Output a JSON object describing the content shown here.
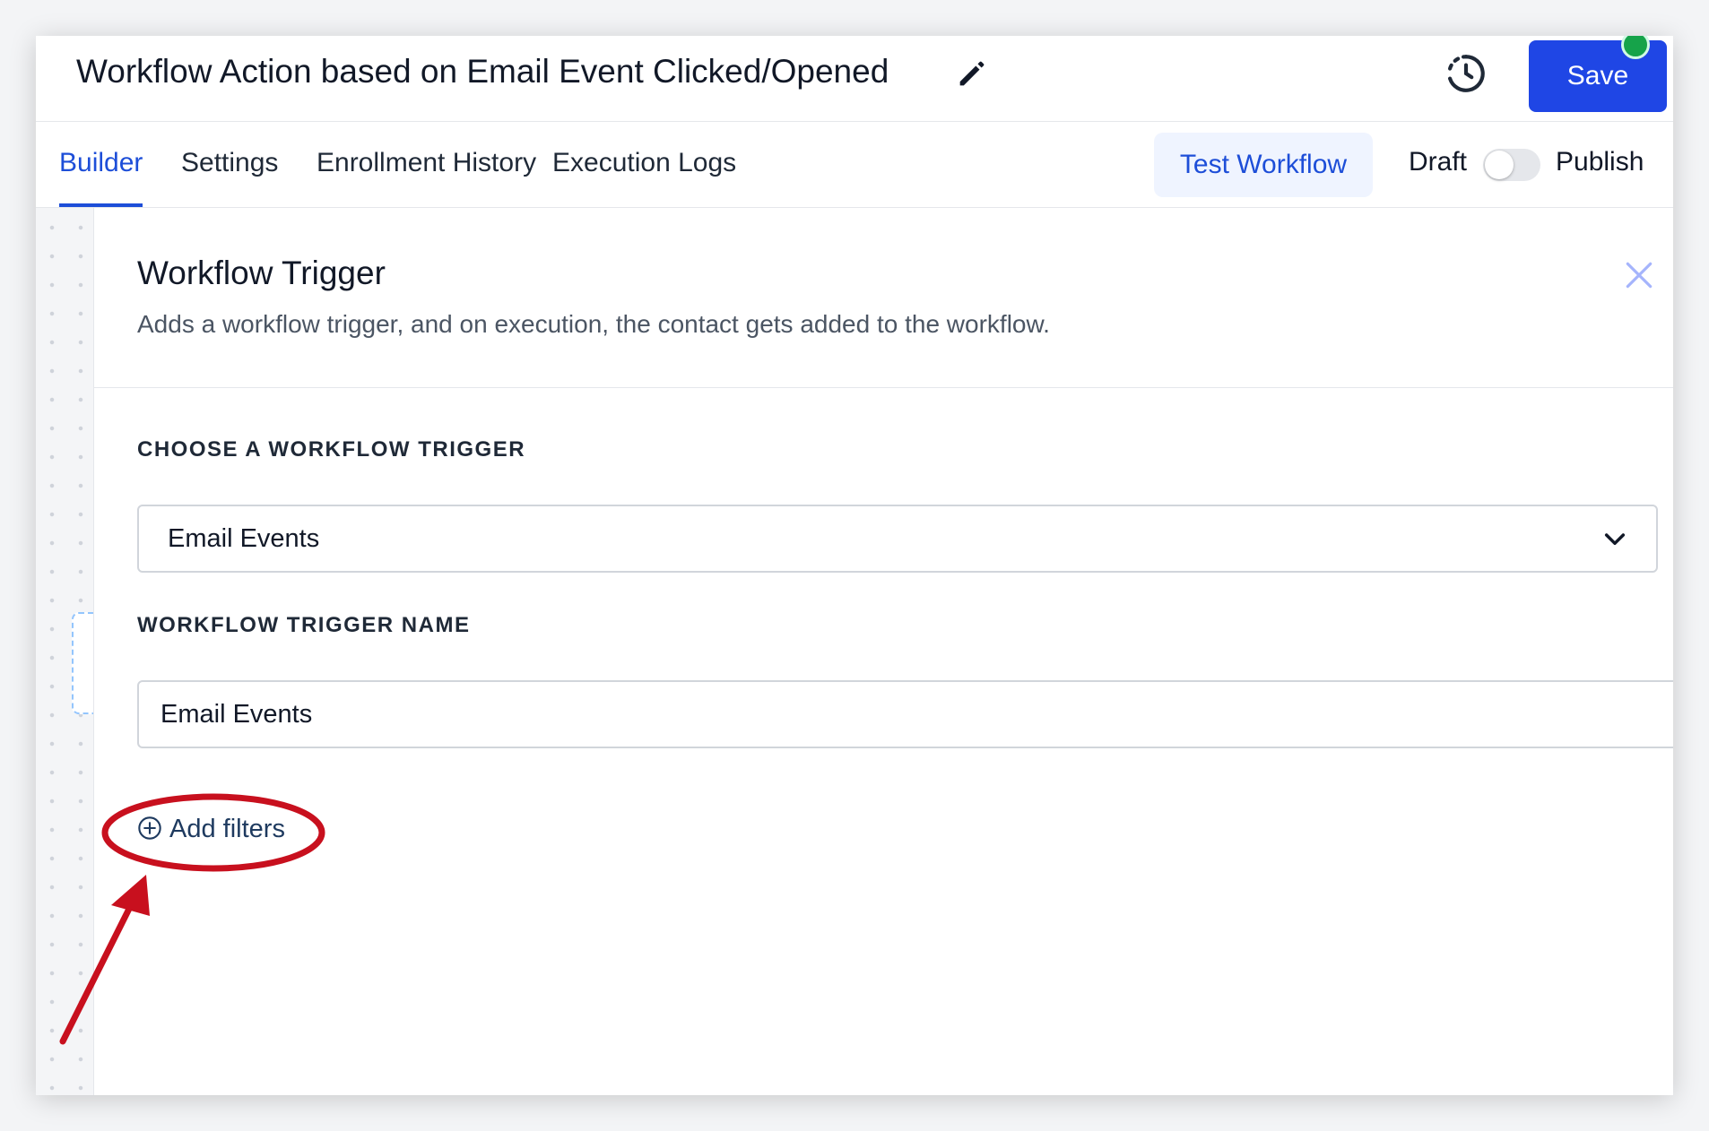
{
  "header": {
    "title": "Workflow Action based on Email Event Clicked/Opened",
    "edit_icon": "pencil-icon",
    "history_icon": "history-icon",
    "save_label": "Save",
    "save_color": "#1f46e5",
    "status_dot_color": "#16a34a"
  },
  "tabs": [
    {
      "label": "Builder",
      "active": true
    },
    {
      "label": "Settings",
      "active": false
    },
    {
      "label": "Enrollment History",
      "active": false
    },
    {
      "label": "Execution Logs",
      "active": false
    }
  ],
  "toolbar": {
    "test_workflow_label": "Test Workflow",
    "draft_label": "Draft",
    "publish_label": "Publish",
    "publish_toggle_on": false
  },
  "panel": {
    "title": "Workflow Trigger",
    "subtitle": "Adds a workflow trigger, and on execution, the contact gets added to the workflow.",
    "close_icon": "close-icon",
    "trigger_label": "CHOOSE A WORKFLOW TRIGGER",
    "trigger_value": "Email Events",
    "trigger_name_label": "WORKFLOW TRIGGER NAME",
    "trigger_name_value": "Email Events",
    "add_filters_label": "Add filters",
    "add_filters_icon": "plus-circle-icon"
  },
  "annotation": {
    "color": "#c8101e",
    "shapes": [
      "ellipse",
      "arrow"
    ]
  },
  "colors": {
    "accent": "#1d4ed8",
    "test_button_bg": "#eff4ff"
  }
}
